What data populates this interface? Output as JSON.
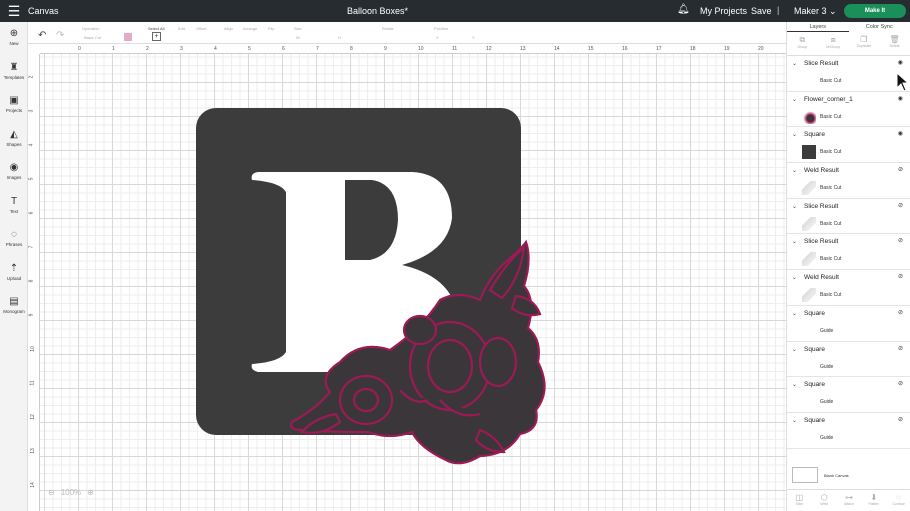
{
  "topbar": {
    "canvas_label": "Canvas",
    "document_title": "Balloon Boxes*",
    "my_projects": "My Projects",
    "save": "Save",
    "separator": "|",
    "machine": "Maker 3",
    "make_it": "Make It"
  },
  "sidebar": {
    "items": [
      {
        "label": "New",
        "icon": "plus-circle-icon",
        "glyph": "⊕"
      },
      {
        "label": "Templates",
        "icon": "shirt-icon",
        "glyph": "♜"
      },
      {
        "label": "Projects",
        "icon": "folder-icon",
        "glyph": "▣"
      },
      {
        "label": "Shapes",
        "icon": "shapes-icon",
        "glyph": "◭"
      },
      {
        "label": "Images",
        "icon": "bulb-icon",
        "glyph": "◉"
      },
      {
        "label": "Text",
        "icon": "text-icon",
        "glyph": "T"
      },
      {
        "label": "Phrases",
        "icon": "chat-icon",
        "glyph": "◌"
      },
      {
        "label": "Upload",
        "icon": "upload-icon",
        "glyph": "⇡"
      },
      {
        "label": "Monogram",
        "icon": "monogram-icon",
        "glyph": "▤"
      }
    ]
  },
  "toolbar": {
    "undo": "↶",
    "redo": "↷",
    "operation_label": "Operation",
    "operation_value": "Basic Cut",
    "select_all": "Select All",
    "edit": "Edit",
    "offset": "Offset",
    "align": "Align",
    "arrange": "Arrange",
    "flip": "Flip",
    "size": "Size",
    "rotate": "Rotate",
    "position": "Position",
    "size_w": "W",
    "size_h": "H",
    "position_x": "X",
    "position_y": "Y"
  },
  "ruler": {
    "top": [
      "0",
      "1",
      "2",
      "3",
      "4",
      "5",
      "6",
      "7",
      "8",
      "9",
      "10",
      "11",
      "12",
      "13",
      "14",
      "15",
      "16",
      "17",
      "18",
      "19",
      "20",
      "21"
    ],
    "left": [
      "2",
      "3",
      "4",
      "5",
      "6",
      "7",
      "8",
      "9",
      "10",
      "11",
      "12",
      "13",
      "14"
    ]
  },
  "canvas": {
    "zoom": "100%",
    "zoom_out": "⊖",
    "zoom_in": "⊕"
  },
  "panel": {
    "tabs": [
      "Layers",
      "Color Sync"
    ],
    "actions": [
      {
        "label": "Group",
        "glyph": "⧉"
      },
      {
        "label": "UnGroup",
        "glyph": "⧈"
      },
      {
        "label": "Duplicate",
        "glyph": "❐"
      },
      {
        "label": "Delete",
        "glyph": "🗑"
      }
    ],
    "layers": [
      {
        "name": "Slice Result",
        "sub": "Basic Cut",
        "visible": true,
        "thumb": "none"
      },
      {
        "name": "Flower_corner_1",
        "sub": "Basic Cut",
        "visible": true,
        "thumb": "flower"
      },
      {
        "name": "Square",
        "sub": "Basic Cut",
        "visible": true,
        "thumb": "dark"
      },
      {
        "name": "Weld Result",
        "sub": "Basic Cut",
        "visible": false,
        "thumb": "light"
      },
      {
        "name": "Slice Result",
        "sub": "Basic Cut",
        "visible": false,
        "thumb": "light"
      },
      {
        "name": "Slice Result",
        "sub": "Basic Cut",
        "visible": false,
        "thumb": "light"
      },
      {
        "name": "Weld Result",
        "sub": "Basic Cut",
        "visible": false,
        "thumb": "light"
      },
      {
        "name": "Square",
        "sub": "Guide",
        "visible": false,
        "thumb": "none"
      },
      {
        "name": "Square",
        "sub": "Guide",
        "visible": false,
        "thumb": "none"
      },
      {
        "name": "Square",
        "sub": "Guide",
        "visible": false,
        "thumb": "none"
      },
      {
        "name": "Square",
        "sub": "Guide",
        "visible": false,
        "thumb": "none"
      }
    ],
    "blank_canvas": "Blank Canvas",
    "bottom": [
      {
        "label": "Slice",
        "glyph": "◫"
      },
      {
        "label": "Weld",
        "glyph": "⬡"
      },
      {
        "label": "Attach",
        "glyph": "⊶"
      },
      {
        "label": "Flatten",
        "glyph": "⬇"
      },
      {
        "label": "Contour",
        "glyph": "◌"
      }
    ]
  },
  "colors": {
    "topbar": "#262c30",
    "square": "#3d3c3d",
    "letter": "#ffffff",
    "flower_fill": "#3a3639",
    "flower_outline": "#9c1a55",
    "make_it": "#1b8f5a"
  }
}
